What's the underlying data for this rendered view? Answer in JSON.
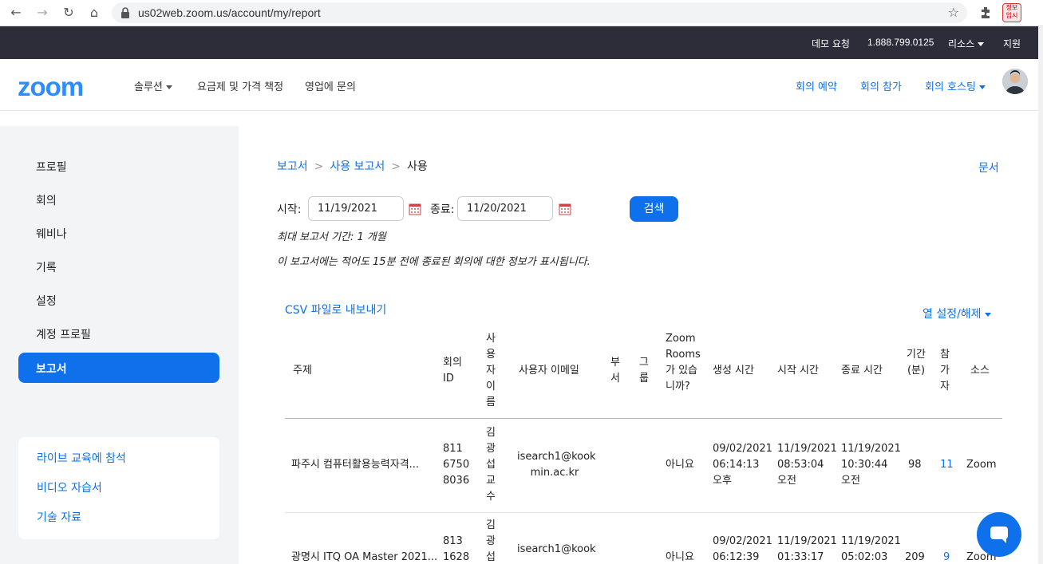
{
  "browser": {
    "url": "us02web.zoom.us/account/my/report",
    "profile_badge": "정보\n입시"
  },
  "topbar": {
    "demo": "데모 요청",
    "phone": "1.888.799.0125",
    "resources": "리소스",
    "support": "지원"
  },
  "header": {
    "logo": "zoom",
    "solutions": "솔루션",
    "pricing": "요금제 및 가격 책정",
    "sales": "영업에 문의",
    "schedule": "회의 예약",
    "join": "회의 참가",
    "host": "회의 호스팅"
  },
  "sidebar": {
    "items": [
      "프로필",
      "회의",
      "웨비나",
      "기록",
      "설정",
      "계정 프로필"
    ],
    "active": "보고서",
    "links": [
      "라이브 교육에 참석",
      "비디오 자습서",
      "기술 자료"
    ]
  },
  "breadcrumb": [
    "보고서",
    "사용 보고서",
    "사용"
  ],
  "docs_link": "문서",
  "filters": {
    "start_label": "시작:",
    "start_value": "11/19/2021",
    "end_label": "종료:",
    "end_value": "11/20/2021",
    "search": "검색",
    "note1": "최대 보고서 기간: 1 개월",
    "note2": "이 보고서에는 적어도 15분 전에 종료된 회의에 대한 정보가 표시됩니다."
  },
  "csv_export": "CSV 파일로 내보내기",
  "column_toggle": "열 설정/해제",
  "table": {
    "headers": {
      "topic": "주제",
      "meeting_id": "회의 ID",
      "user_name": "사용자 이름",
      "email": "사용자 이메일",
      "dept": "부서",
      "group": "그룹",
      "zoom_rooms": "Zoom Rooms가 있습니까?",
      "created": "생성 시간",
      "start": "시작 시간",
      "end": "종료 시간",
      "duration": "기간 (분)",
      "participants": "참가자",
      "source": "소스"
    },
    "rows": [
      {
        "topic": "파주시 컴퓨터활용능력자격...",
        "id": [
          "811",
          "6750",
          "8036"
        ],
        "user": [
          "김",
          "광",
          "섭",
          "교",
          "수"
        ],
        "email": [
          "isearch1@kook",
          "min.ac.kr"
        ],
        "rooms": "아니요",
        "created": [
          "09/02/2021",
          "06:14:13",
          "오후"
        ],
        "start": [
          "11/19/2021",
          "08:53:04",
          "오전"
        ],
        "end": [
          "11/19/2021",
          "10:30:44",
          "오전"
        ],
        "duration": "98",
        "participants": "11",
        "source": "Zoom"
      },
      {
        "topic": "광명시 ITQ OA Master 2021...",
        "id": [
          "813",
          "1628"
        ],
        "user": [
          "김",
          "광",
          "섭"
        ],
        "email": [
          "isearch1@kook"
        ],
        "rooms": "아니요",
        "created": [
          "09/02/2021",
          "06:12:39"
        ],
        "start": [
          "11/19/2021",
          "01:33:17"
        ],
        "end": [
          "11/19/2021",
          "05:02:03"
        ],
        "duration": "209",
        "participants": "9",
        "source": "Zoom"
      }
    ]
  }
}
